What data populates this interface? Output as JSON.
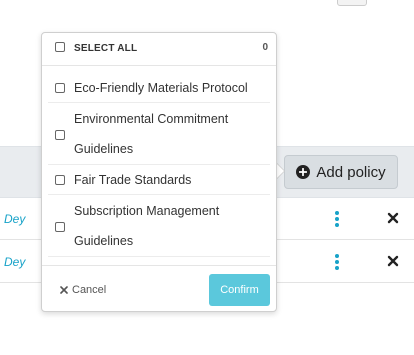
{
  "page": {
    "add_policy_label": "Add policy",
    "rows": [
      {
        "owner": "Dey"
      },
      {
        "owner": "Dey"
      }
    ]
  },
  "dropdown": {
    "select_all_label": "SELECT ALL",
    "selected_count": "0",
    "options": [
      {
        "label": "Eco-Friendly Materials Protocol",
        "checked": false
      },
      {
        "label": "Environmental Commitment Guidelines",
        "checked": false
      },
      {
        "label": "Fair Trade Standards",
        "checked": false
      },
      {
        "label": "Subscription Management Guidelines",
        "checked": false
      }
    ],
    "cancel_label": "Cancel",
    "confirm_label": "Confirm"
  },
  "colors": {
    "accent": "#17a2c8",
    "confirm_bg": "#5bc8dc",
    "toolbar_bg": "#e9ecef"
  },
  "icons": {
    "add": "plus-circle-icon",
    "row_menu": "kebab-menu-icon",
    "row_remove": "close-icon",
    "cancel": "close-icon"
  }
}
